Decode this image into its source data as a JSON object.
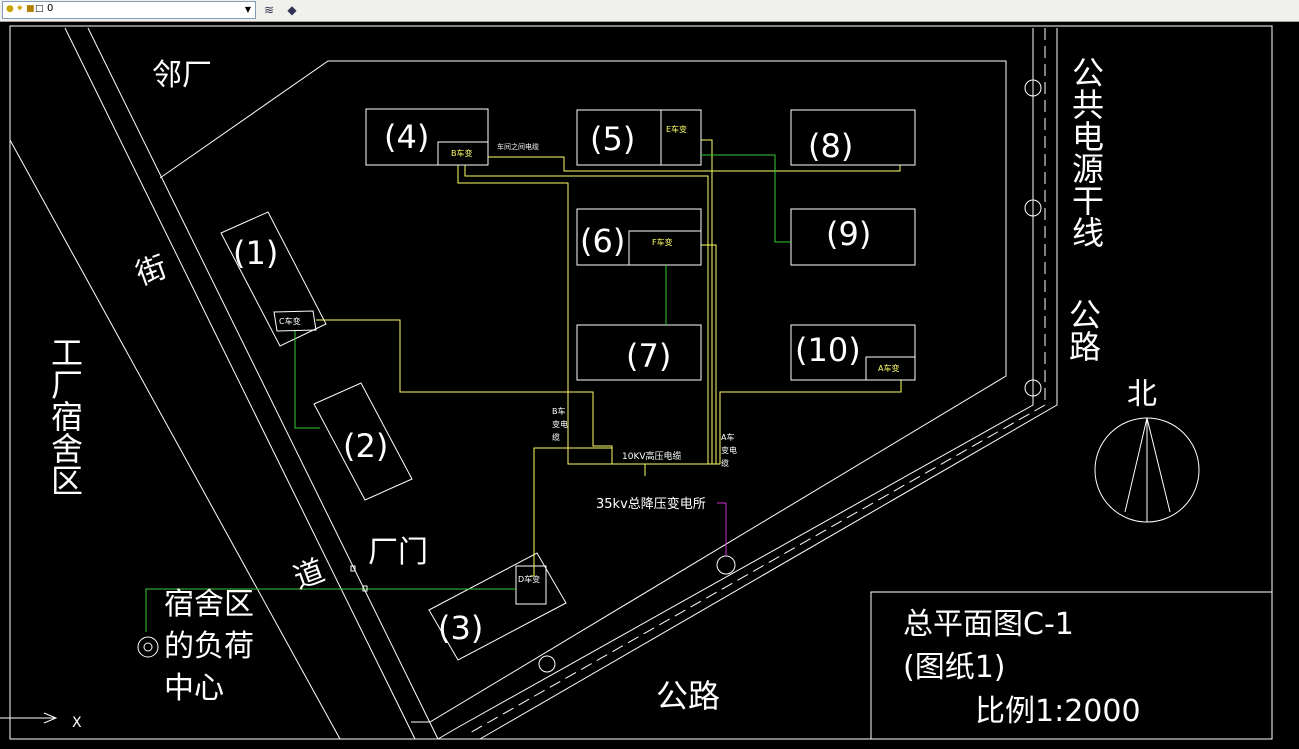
{
  "toolbar": {
    "layer_name": "0",
    "layer_icons": [
      "lightbulb-icon",
      "sun-icon",
      "lock-icon",
      "color-square-icon"
    ],
    "buttons": [
      "layer-properties-icon",
      "layer-states-icon"
    ]
  },
  "labels": {
    "neighbor_factory": "邻厂",
    "street_1": "街",
    "street_2": "道",
    "dormitory": "工厂宿舍区",
    "dorm_load_center": [
      "宿舍区",
      "的负荷",
      "中心"
    ],
    "public_power_line": "公共电源干线",
    "road_right": "公路",
    "road_bottom": "公路",
    "factory_gate": "厂门",
    "north": "北",
    "substation": "35kv总降压变电所",
    "cable_10kv": "10KV高压电缆",
    "cable_between": "车间之间电缆",
    "b_cable": [
      "B车",
      "变电",
      "缆"
    ],
    "a_cable": [
      "A车",
      "变电",
      "缆"
    ]
  },
  "buildings": {
    "b1": "(1)",
    "b2": "(2)",
    "b3": "(3)",
    "b4": "(4)",
    "b5": "(5)",
    "b6": "(6)",
    "b7": "(7)",
    "b8": "(8)",
    "b9": "(9)",
    "b10": "(10)"
  },
  "transformers": {
    "a": "A车变",
    "b": "B车变",
    "c": "C车变",
    "d": "D车变",
    "e": "E车变",
    "f": "F车变"
  },
  "title_block": {
    "title": "总平面图C-1",
    "sheet": "(图纸1)",
    "scale": "比例1:2000"
  },
  "ucs": {
    "x_label": "X"
  },
  "colors": {
    "background": "#000000",
    "lines": "#ffffff",
    "cable_yellow": "#ffff66",
    "cable_green": "#33cc33",
    "cable_magenta": "#cc33cc"
  }
}
